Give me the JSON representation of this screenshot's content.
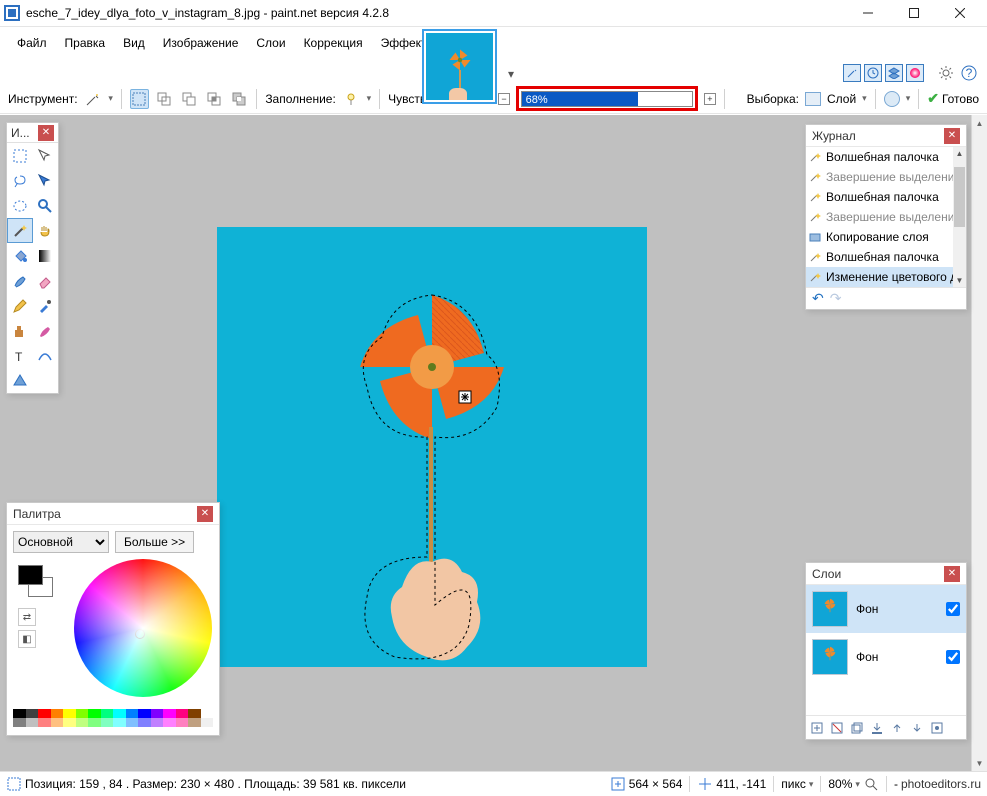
{
  "title": "esche_7_idey_dlya_foto_v_instagram_8.jpg - paint.net версия 4.2.8",
  "menus": [
    "Файл",
    "Правка",
    "Вид",
    "Изображение",
    "Слои",
    "Коррекция",
    "Эффекты"
  ],
  "options": {
    "tool_label": "Инструмент:",
    "fill_label": "Заполнение:",
    "tolerance_label": "Чувствительность:",
    "tolerance_value": "68%",
    "selection_label": "Выборка:",
    "selection_mode": "Слой",
    "done_label": "Готово"
  },
  "toolbox": {
    "title": "И..."
  },
  "colors": {
    "title": "Палитра",
    "mode": "Основной",
    "more": "Больше >>",
    "palette_row1": [
      "#000000",
      "#404040",
      "#ff0000",
      "#ff8000",
      "#ffff00",
      "#80ff00",
      "#00ff00",
      "#00ff80",
      "#00ffff",
      "#0080ff",
      "#0000ff",
      "#8000ff",
      "#ff00ff",
      "#ff0080",
      "#804000",
      "#ffffff"
    ],
    "palette_row2": [
      "#808080",
      "#c0c0c0",
      "#ff8080",
      "#ffc080",
      "#ffff80",
      "#c0ff80",
      "#80ff80",
      "#80ffc0",
      "#80ffff",
      "#80c0ff",
      "#8080ff",
      "#c080ff",
      "#ff80ff",
      "#ff80c0",
      "#c0a080",
      "#f0f0f0"
    ]
  },
  "history": {
    "title": "Журнал",
    "items": [
      {
        "label": "Волшебная палочка",
        "icon": "wand",
        "fade": false
      },
      {
        "label": "Завершение выделения палочкой",
        "icon": "wand",
        "fade": true
      },
      {
        "label": "Волшебная палочка",
        "icon": "wand",
        "fade": false
      },
      {
        "label": "Завершение выделения палочкой",
        "icon": "wand",
        "fade": true
      },
      {
        "label": "Копирование слоя",
        "icon": "layer",
        "fade": false
      },
      {
        "label": "Волшебная палочка",
        "icon": "wand",
        "fade": false
      },
      {
        "label": "Изменение цветового диапазона",
        "icon": "wand",
        "fade": false,
        "sel": true
      }
    ]
  },
  "layers": {
    "title": "Слои",
    "items": [
      {
        "name": "Фон",
        "checked": true,
        "sel": true
      },
      {
        "name": "Фон",
        "checked": true,
        "sel": false
      }
    ]
  },
  "status": {
    "icon_label": "",
    "text": "Позиция: 159 , 84 . Размер: 230   × 480 . Площадь: 39 581 кв. пиксели",
    "canvas_size": "564  ×  564",
    "cursor_pos": "411, -141",
    "units": "пикс",
    "zoom": "80%",
    "brand": "photoeditors.ru"
  }
}
